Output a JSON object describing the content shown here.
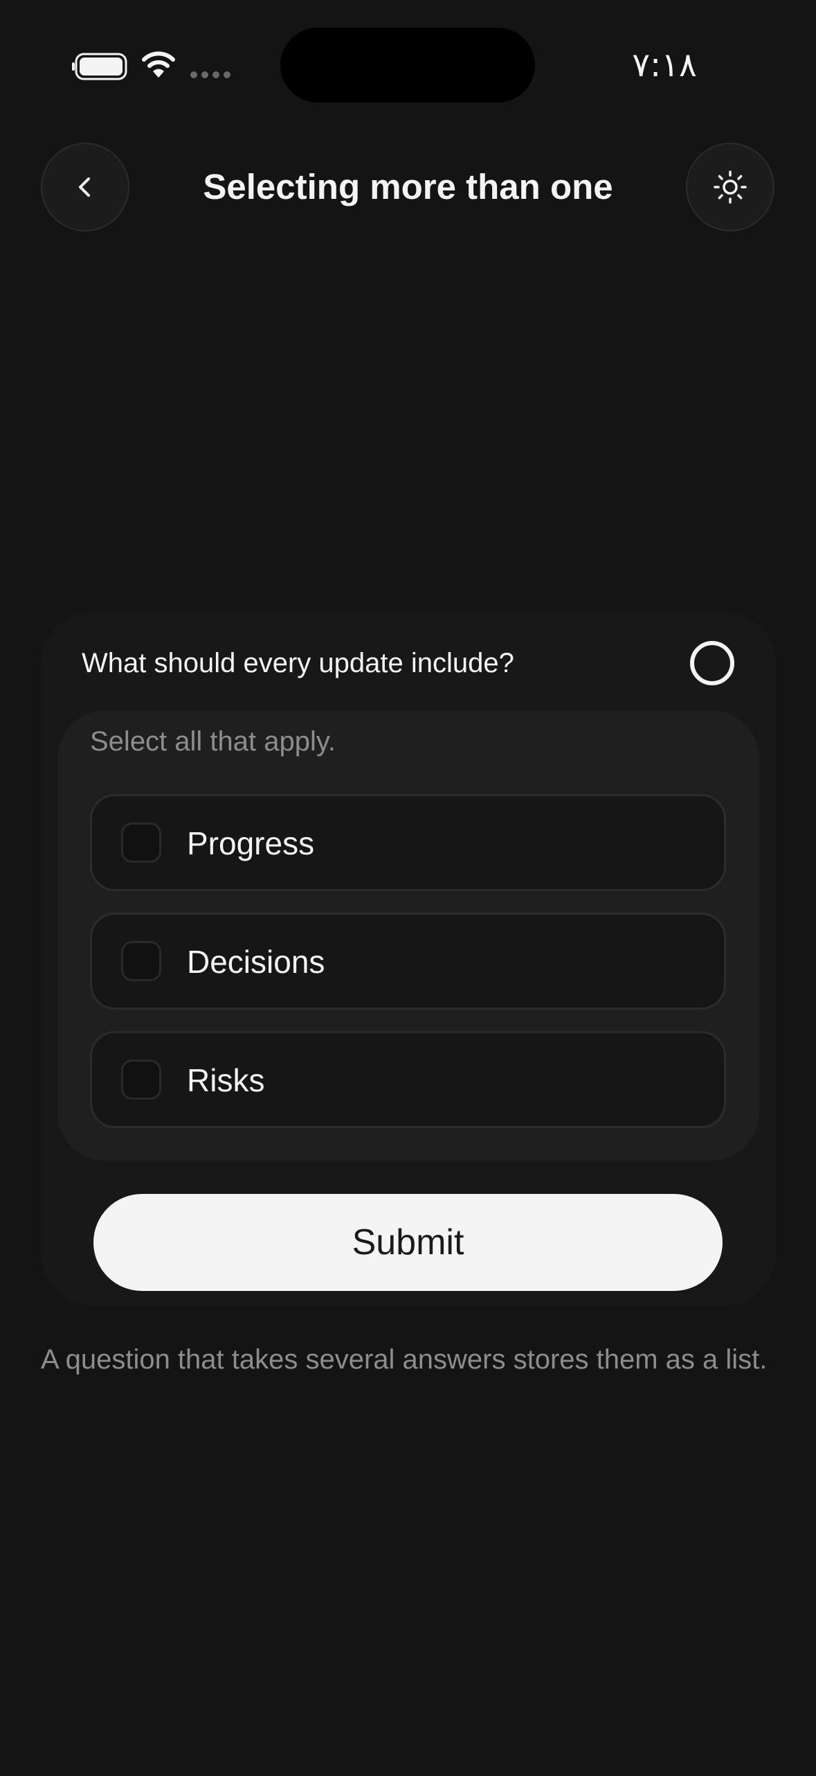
{
  "status_bar": {
    "time": "٧:١٨",
    "battery_icon": "battery-icon",
    "wifi_icon": "wifi-icon",
    "signal_icon": "cellular-signal-dots-icon"
  },
  "header": {
    "title": "Selecting more than one",
    "back_icon": "chevron-left-icon",
    "theme_icon": "sun-icon"
  },
  "card": {
    "question": "What should every update include?",
    "status_icon": "empty-circle-icon",
    "instructions": "Select all that apply.",
    "options": [
      {
        "label": "Progress",
        "checked": false
      },
      {
        "label": "Decisions",
        "checked": false
      },
      {
        "label": "Risks",
        "checked": false
      }
    ],
    "submit_label": "Submit"
  },
  "footnote": "A question that takes several answers stores them as a list.",
  "colors": {
    "background": "#141414",
    "card": "#181818",
    "panel": "#1f1f1f",
    "submit": "#f4f4f4",
    "muted_text": "#8d8d8d"
  }
}
